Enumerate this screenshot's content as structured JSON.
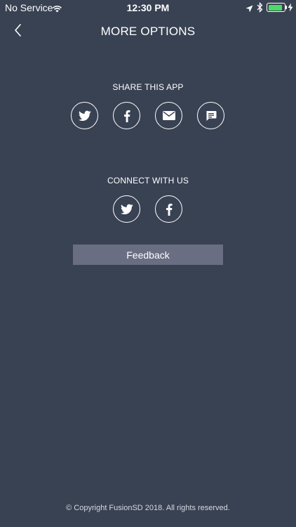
{
  "status_bar": {
    "carrier": "No Service",
    "time": "12:30 PM",
    "battery_level": 0.9,
    "icons": [
      "wifi-icon",
      "location-arrow-icon",
      "bluetooth-icon",
      "battery-icon",
      "charging-bolt-icon"
    ]
  },
  "nav": {
    "title": "MORE OPTIONS",
    "back_icon": "chevron-left-icon"
  },
  "share": {
    "label": "SHARE THIS APP",
    "buttons": [
      {
        "icon": "twitter-icon"
      },
      {
        "icon": "facebook-icon"
      },
      {
        "icon": "envelope-icon"
      },
      {
        "icon": "message-icon"
      }
    ]
  },
  "connect": {
    "label": "CONNECT WITH US",
    "buttons": [
      {
        "icon": "twitter-icon"
      },
      {
        "icon": "facebook-icon"
      }
    ]
  },
  "feedback": {
    "label": "Feedback"
  },
  "footer": {
    "copyright": "© Copyright FusionSD 2018. All rights reserved."
  },
  "colors": {
    "background": "#394253",
    "feedback_button": "#6a6e82",
    "battery": "#4cd964",
    "text": "#ffffff"
  }
}
